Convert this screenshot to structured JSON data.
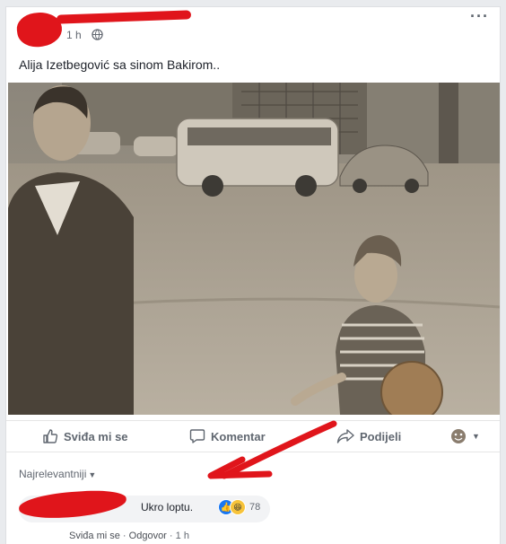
{
  "post": {
    "time": "1 h",
    "text": "Alija Izetbegović sa sinom Bakirom.."
  },
  "actions": {
    "like": "Sviđa mi se",
    "comment": "Komentar",
    "share": "Podijeli"
  },
  "sort": {
    "label": "Najrelevantniji"
  },
  "comment": {
    "text": "Ukro loptu.",
    "reaction_count": "78",
    "like": "Sviđa mi se",
    "separator": "·",
    "reply": "Odgovor",
    "time": "1 h"
  },
  "colors": {
    "redaction": "#e0151b",
    "facebook_blue": "#1877f2",
    "muted": "#616770"
  },
  "icons": [
    "globe-icon",
    "more-icon",
    "thumbs-up-icon",
    "comment-icon",
    "share-icon",
    "emoji-icon"
  ]
}
